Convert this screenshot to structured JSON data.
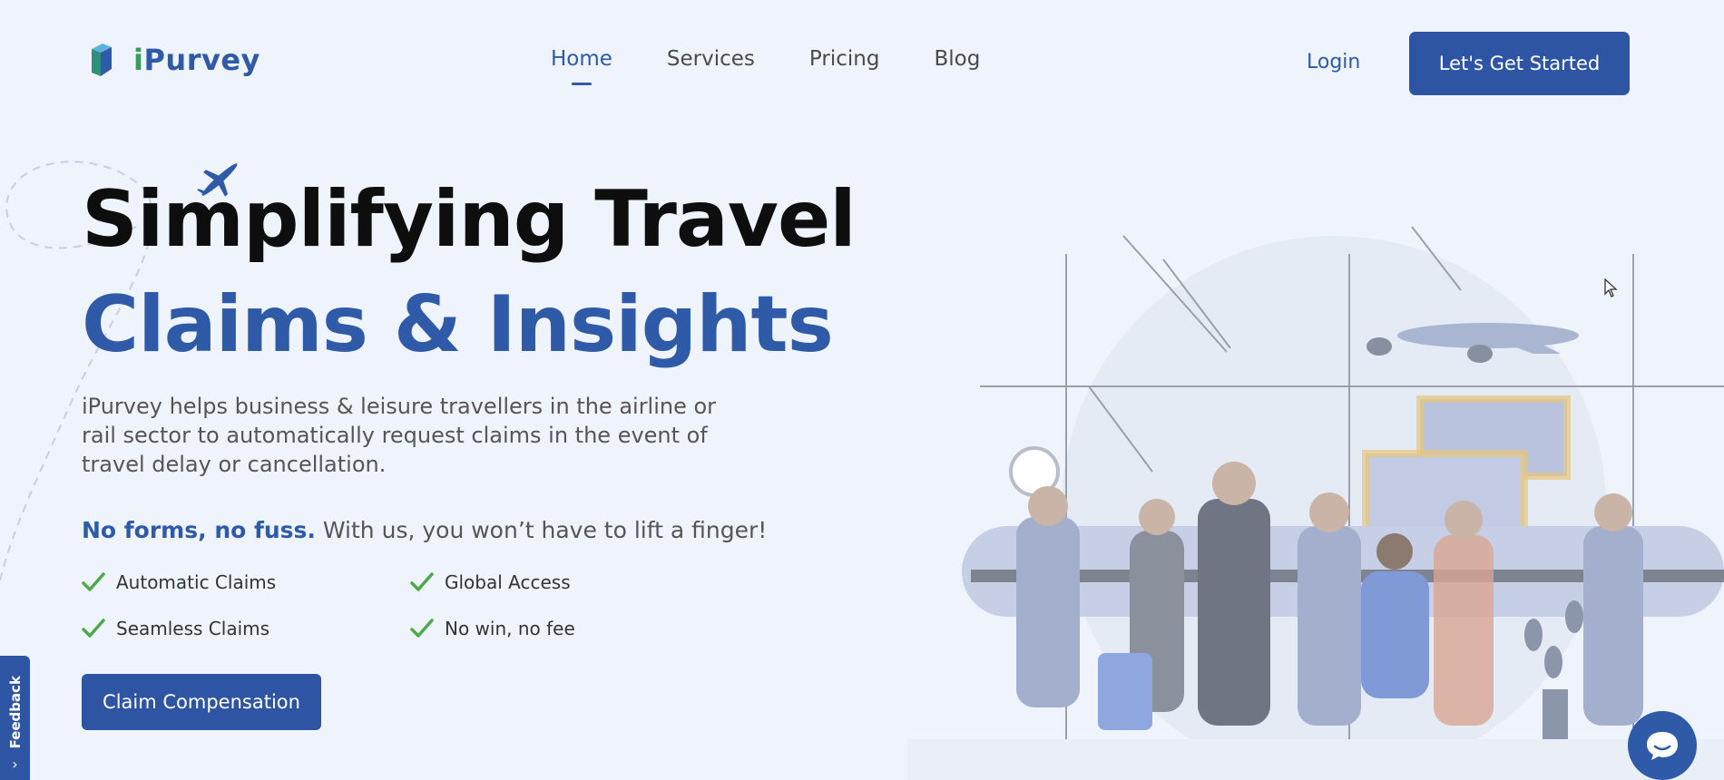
{
  "brand": {
    "name_prefix": "i",
    "name_rest": "Purvey",
    "logo_icon": "cube-logo-icon"
  },
  "nav": {
    "items": [
      {
        "label": "Home",
        "active": true
      },
      {
        "label": "Services",
        "active": false
      },
      {
        "label": "Pricing",
        "active": false
      },
      {
        "label": "Blog",
        "active": false
      }
    ]
  },
  "header": {
    "login_label": "Login",
    "cta_label": "Let's Get Started"
  },
  "hero": {
    "title_line1": "Simplifying Travel",
    "title_line2": "Claims & Insights",
    "description": "iPurvey helps business & leisure travellers in the airline or rail sector to automatically request claims in the event of travel delay or cancellation.",
    "tagline_bold": "No forms, no fuss.",
    "tagline_rest": " With us, you won’t have to lift a finger!",
    "features": [
      "Automatic Claims",
      "Global Access",
      "Seamless Claims",
      "No win, no fee"
    ],
    "claim_button_label": "Claim Compensation"
  },
  "feedback": {
    "label": "Feedback"
  },
  "colors": {
    "primary": "#2e5aa8",
    "accent_green": "#3d9a5a",
    "background": "#eff4fc"
  },
  "icons": {
    "check": "check-icon",
    "plane": "airplane-icon",
    "chat": "chat-bubble-icon",
    "chevron": "chevron-right-icon",
    "cursor": "mouse-cursor-icon"
  }
}
